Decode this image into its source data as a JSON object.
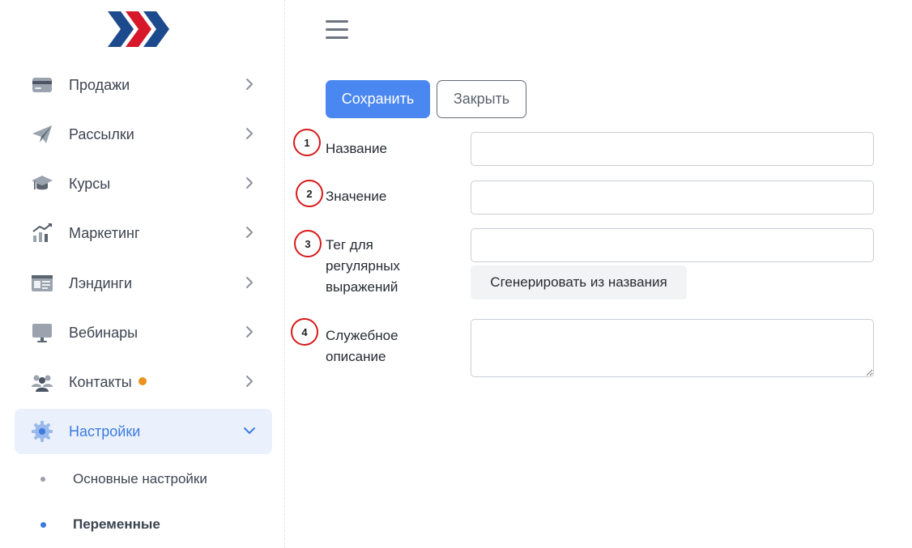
{
  "sidebar": {
    "items": [
      {
        "label": "Продажи",
        "icon": "card-icon"
      },
      {
        "label": "Рассылки",
        "icon": "paper-plane-icon"
      },
      {
        "label": "Курсы",
        "icon": "graduation-cap-icon"
      },
      {
        "label": "Маркетинг",
        "icon": "chart-icon"
      },
      {
        "label": "Лэндинги",
        "icon": "landing-page-icon"
      },
      {
        "label": "Вебинары",
        "icon": "monitor-icon"
      },
      {
        "label": "Контакты",
        "icon": "users-icon"
      },
      {
        "label": "Настройки",
        "icon": "gear-icon"
      }
    ],
    "subitems": [
      {
        "label": "Основные настройки"
      },
      {
        "label": "Переменные"
      }
    ]
  },
  "toolbar": {
    "save_label": "Сохранить",
    "close_label": "Закрыть"
  },
  "form": {
    "markers": [
      "1",
      "2",
      "3",
      "4"
    ],
    "name_label": "Название",
    "value_label": "Значение",
    "tag_label_line1": "Тег для",
    "tag_label_line2": "регулярных",
    "tag_label_line3": "выражений",
    "generate_label": "Сгенерировать из названия",
    "desc_label_line1": "Служебное",
    "desc_label_line2": "описание",
    "name_value": "",
    "value_value": "",
    "tag_value": "",
    "desc_value": ""
  },
  "colors": {
    "accent": "#4a87f0",
    "active_bg": "#eaf1fd",
    "marker": "#d71a1a",
    "badge": "#e9921f",
    "logo_blue": "#1d4a8c",
    "logo_red": "#d7182a"
  }
}
